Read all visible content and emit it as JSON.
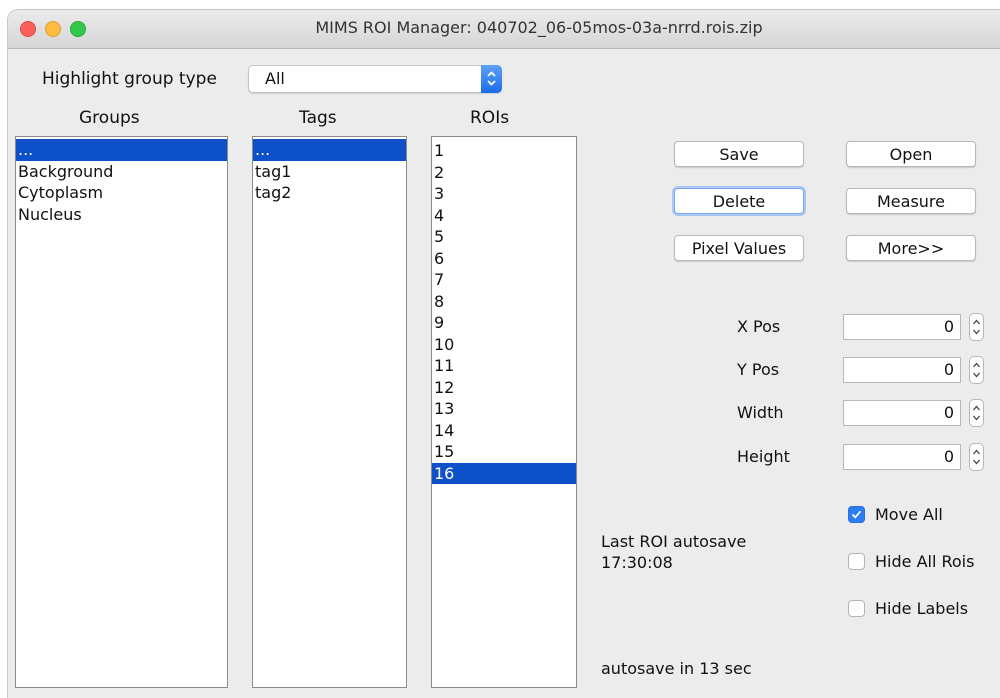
{
  "window": {
    "title": "MIMS ROI Manager: 040702_06-05mos-03a-nrrd.rois.zip"
  },
  "highlight": {
    "label": "Highlight group type",
    "value": "All"
  },
  "groups": {
    "header": "Groups",
    "items": [
      "...",
      "Background",
      "Cytoplasm",
      "Nucleus"
    ],
    "selected": 0
  },
  "tags": {
    "header": "Tags",
    "items": [
      "...",
      "tag1",
      "tag2"
    ],
    "selected": 0
  },
  "rois": {
    "header": "ROIs",
    "items": [
      "1",
      "2",
      "3",
      "4",
      "5",
      "6",
      "7",
      "8",
      "9",
      "10",
      "11",
      "12",
      "13",
      "14",
      "15",
      "16"
    ],
    "selected": 15
  },
  "buttons": {
    "save": "Save",
    "open": "Open",
    "delete": "Delete",
    "measure": "Measure",
    "pixel_values": "Pixel Values",
    "more": "More>>"
  },
  "fields": {
    "xpos": {
      "label": "X Pos",
      "value": "0"
    },
    "ypos": {
      "label": "Y Pos",
      "value": "0"
    },
    "width": {
      "label": "Width",
      "value": "0"
    },
    "height": {
      "label": "Height",
      "value": "0"
    }
  },
  "options": {
    "move_all": {
      "label": "Move All",
      "checked": true
    },
    "hide_all_rois": {
      "label": "Hide All Rois",
      "checked": false
    },
    "hide_labels": {
      "label": "Hide Labels",
      "checked": false
    }
  },
  "autosave": {
    "last_label": "Last ROI autosave",
    "last_time": "17:30:08",
    "countdown": "autosave in 13 sec"
  },
  "colors": {
    "selection": "#0d50c7",
    "accent": "#2e7df5"
  },
  "icons": {
    "select": "up-down-chevron-icon",
    "spinner": "spinner-arrows-icon",
    "check": "checkmark-icon"
  }
}
